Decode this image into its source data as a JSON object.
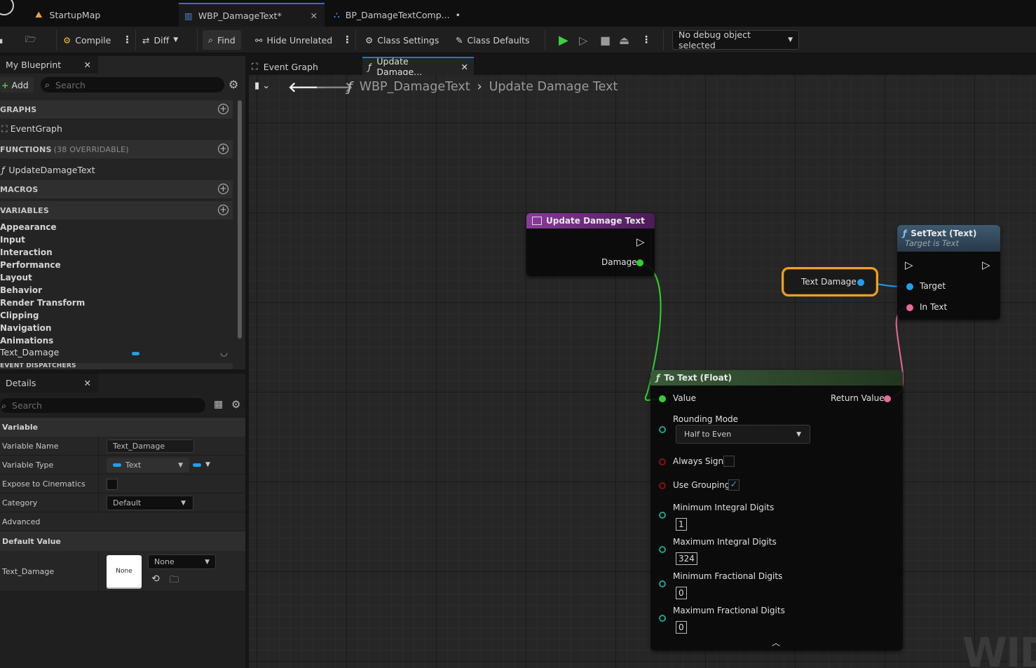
{
  "tabs": [
    {
      "label": "StartupMap"
    },
    {
      "label": "WBP_DamageText*"
    },
    {
      "label": "BP_DamageTextComp...",
      "modified": "•"
    }
  ],
  "toolbar": {
    "compile": "Compile",
    "diff": "Diff",
    "find": "Find",
    "hide_unrelated": "Hide Unrelated",
    "class_settings": "Class Settings",
    "class_defaults": "Class Defaults",
    "debug_object": "No debug object selected"
  },
  "my_blueprint": {
    "title": "My Blueprint",
    "add": "Add",
    "search_placeholder": "Search",
    "sections": {
      "graphs": "GRAPHS",
      "functions": "FUNCTIONS",
      "functions_count": "(38 OVERRIDABLE)",
      "macros": "MACROS",
      "variables": "VARIABLES",
      "event_dispatchers": "EVENT DISPATCHERS"
    },
    "graph_items": [
      "EventGraph"
    ],
    "function_items": [
      "UpdateDamageText"
    ],
    "variable_categories": [
      "Appearance",
      "Input",
      "Interaction",
      "Performance",
      "Layout",
      "Behavior",
      "Render Transform",
      "Clipping",
      "Navigation",
      "Animations"
    ],
    "variable": "Text_Damage"
  },
  "details": {
    "title": "Details",
    "search_placeholder": "Search",
    "variable_section": "Variable",
    "variable_name_label": "Variable Name",
    "variable_name": "Text_Damage",
    "variable_type_label": "Variable Type",
    "variable_type": "Text",
    "expose_label": "Expose to Cinematics",
    "category_label": "Category",
    "category": "Default",
    "advanced": "Advanced",
    "default_value_section": "Default Value",
    "default_var_label": "Text_Damage",
    "preview": "None",
    "default_select": "None"
  },
  "graph_tabs": {
    "event_graph": "Event Graph",
    "update_damage": "Update Damage..."
  },
  "breadcrumb": {
    "root": "WBP_DamageText",
    "current": "Update Damage Text"
  },
  "nodes": {
    "entry": {
      "title": "Update Damage Text",
      "pin_damage": "Damage"
    },
    "text_damage": {
      "label": "Text Damage"
    },
    "settext": {
      "title": "SetText (Text)",
      "subtitle": "Target is Text",
      "pin_target": "Target",
      "pin_intext": "In Text"
    },
    "totext": {
      "title": "To Text (Float)",
      "pin_value": "Value",
      "pin_return": "Return Value",
      "rounding_label": "Rounding Mode",
      "rounding_value": "Half to Even",
      "always_sign": "Always Sign",
      "use_grouping": "Use Grouping",
      "min_int_label": "Minimum Integral Digits",
      "min_int": "1",
      "max_int_label": "Maximum Integral Digits",
      "max_int": "324",
      "min_frac_label": "Minimum Fractional Digits",
      "min_frac": "0",
      "max_frac_label": "Maximum Fractional Digits",
      "max_frac": "0"
    }
  },
  "watermark": "WID",
  "colors": {
    "float_pin": "#2fd12f",
    "text_pin": "#e8689a",
    "object_pin": "#1ea0ec",
    "function_header": "#7a2c8c",
    "accent": "#2d6fd6",
    "selection": "#f0a020"
  }
}
